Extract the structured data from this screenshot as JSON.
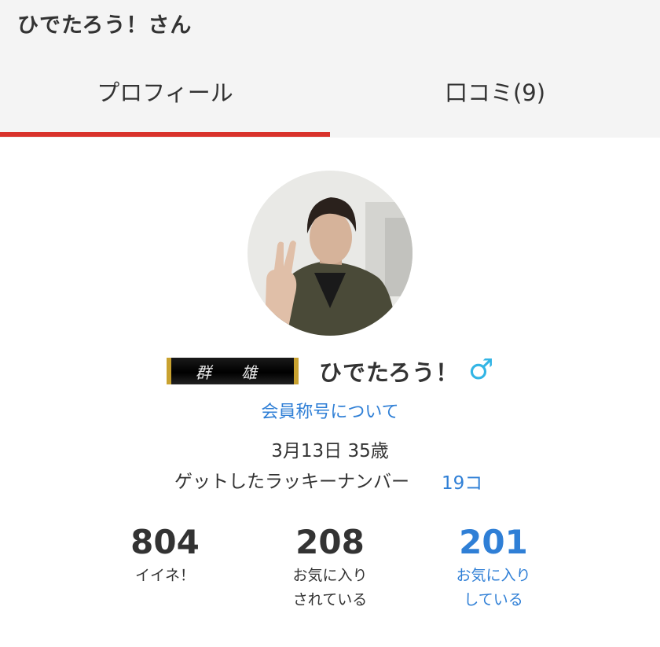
{
  "header": {
    "title": "ひでたろう！さん"
  },
  "tabs": [
    {
      "label": "プロフィール",
      "active": true
    },
    {
      "label": "口コミ(9)",
      "active": false
    }
  ],
  "profile": {
    "title_badge": "群 雄",
    "username": "ひでたろう！",
    "gender_symbol": "♂",
    "title_link": "会員称号について",
    "birthday_age": "3月13日 35歳",
    "lucky_label": "ゲットしたラッキーナンバー",
    "lucky_value": "19コ"
  },
  "stats": [
    {
      "value": "804",
      "label_line1": "イイネ！",
      "label_line2": ""
    },
    {
      "value": "208",
      "label_line1": "お気に入り",
      "label_line2": "されている"
    },
    {
      "value": "201",
      "label_line1": "お気に入り",
      "label_line2": "している"
    }
  ],
  "colors": {
    "accent_red": "#d9322b",
    "link_blue": "#2f7fd6",
    "gender_blue": "#33b5e5",
    "header_bg": "#f4f4f4"
  }
}
